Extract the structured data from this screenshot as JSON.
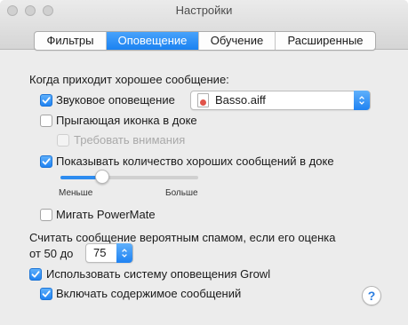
{
  "window": {
    "title": "Настройки"
  },
  "tabs": [
    {
      "label": "Фильтры",
      "active": false
    },
    {
      "label": "Оповещение",
      "active": true
    },
    {
      "label": "Обучение",
      "active": false
    },
    {
      "label": "Расширенные",
      "active": false
    }
  ],
  "good_message": {
    "heading": "Когда приходит хорошее сообщение:",
    "sound_alert": {
      "label": "Звуковое оповещение",
      "checked": true
    },
    "sound_popup": {
      "value": "Basso.aiff",
      "icon": "audio-file-icon"
    },
    "bounce_icon": {
      "label": "Прыгающая иконка в доке",
      "checked": false
    },
    "require_attention": {
      "label": "Требовать внимания",
      "checked": false,
      "enabled": false
    },
    "show_count": {
      "label": "Показывать количество хороших сообщений в доке",
      "checked": true
    },
    "slider": {
      "min_label": "Меньше",
      "max_label": "Больше",
      "level": 0.3
    },
    "powermate": {
      "label": "Мигать PowerMate",
      "checked": false
    }
  },
  "spam": {
    "line1": "Считать сообщение вероятным спамом, если его оценка",
    "prefix": "от 50 до",
    "threshold": "75"
  },
  "growl": {
    "use_growl": {
      "label": "Использовать систему оповещения Growl",
      "checked": true
    },
    "include_content": {
      "label": "Включать содержимое сообщений",
      "checked": true
    }
  },
  "help": {
    "glyph": "?"
  },
  "colors": {
    "accent": "#1b82f1"
  }
}
